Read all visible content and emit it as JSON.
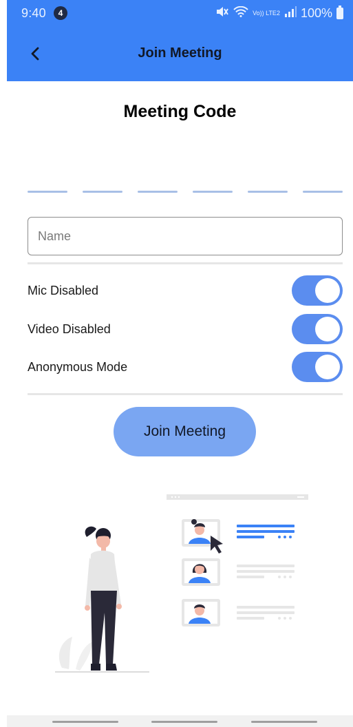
{
  "status_bar": {
    "time": "9:40",
    "notification_count": "4",
    "lte_label": "Vo)) LTE2",
    "battery": "100%"
  },
  "app_bar": {
    "title": "Join Meeting",
    "back_icon": "back-arrow-icon"
  },
  "meeting_code": {
    "title": "Meeting Code",
    "slots": 6
  },
  "name_field": {
    "placeholder": "Name",
    "value": ""
  },
  "toggles": [
    {
      "label": "Mic Disabled",
      "on": true
    },
    {
      "label": "Video Disabled",
      "on": true
    },
    {
      "label": "Anonymous Mode",
      "on": true
    }
  ],
  "join_button": {
    "label": "Join Meeting"
  },
  "colors": {
    "primary": "#3b82f6",
    "toggle": "#5b8def",
    "join_button": "#7aa6f2"
  },
  "illustration": {
    "name": "video-conference-illustration"
  }
}
